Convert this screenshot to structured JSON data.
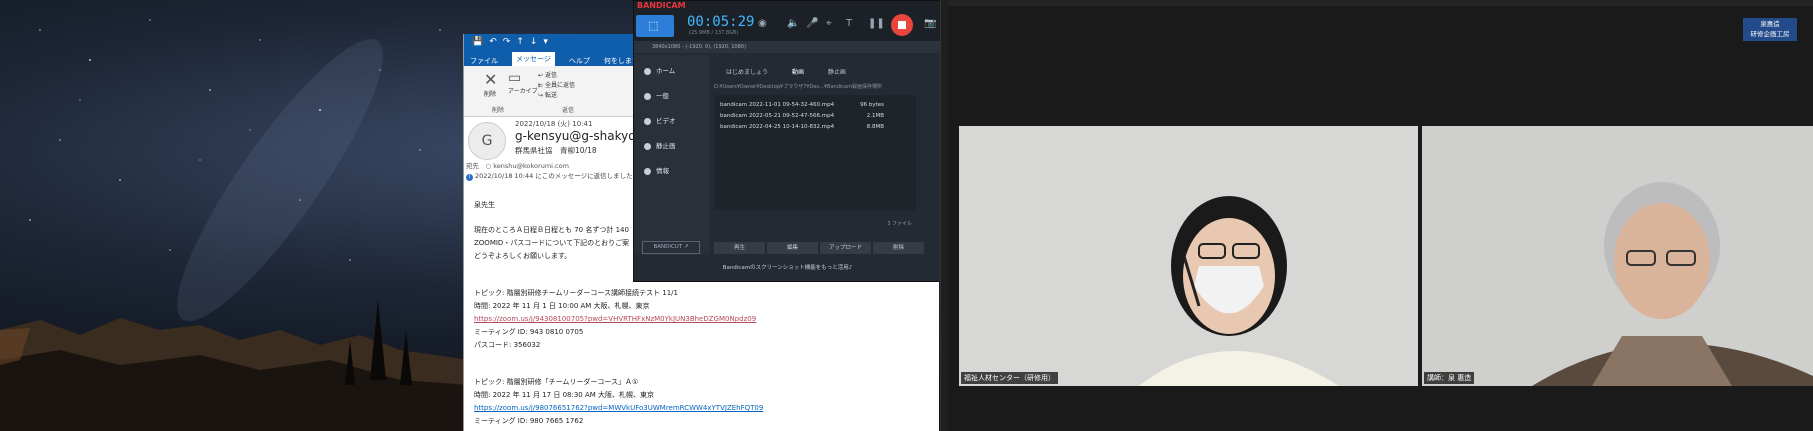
{
  "outlook": {
    "tabs": [
      "ファイル",
      "メッセージ",
      "ヘルプ",
      "何をしますか"
    ],
    "active_tab": "メッセージ",
    "ribbon": {
      "delete_label": "削除",
      "archive_label": "アーカイブ",
      "delete_group": "削除",
      "reply_label": "返信",
      "reply_all_label": "全員に返信",
      "forward_label": "転送",
      "reply_group": "返信"
    },
    "message": {
      "date": "2022/10/18 (火) 10:41",
      "from": "g-kensyu@g-shakyo.or",
      "org": "群馬県社協　青柳10/18",
      "to": "宛先　○ kenshu@kokorumi.com",
      "info": "2022/10/18 10:44 にこのメッセージに返信しました。",
      "avatar": "G"
    },
    "body": {
      "greeting": "泉先生",
      "p1": "現在のところＡ日程Ｂ日程とも 70 名ずつ計 140",
      "p2": "ZOOMID・パスコードについて下記のとおりご案",
      "p3": "どうぞよろしくお願いします。",
      "t1_topic": "トピック: 階層別研修チームリーダーコース講師接続テスト 11/1",
      "t1_time": "時間: 2022 年 11 月 1 日 10:00 AM 大阪、札幌、東京",
      "t1_link": "https://zoom.us/j/94308100705?pwd=VHVRTHFxNzM0YkJUN3BheDZGM0Npdz09",
      "t1_id": "ミーティング ID: 943 0810 0705",
      "t1_pass": "パスコード: 356032",
      "t2_topic": "トピック: 階層別研修「チームリーダーコース」Ａ①",
      "t2_time": "時間: 2022 年 11 月 17 日 08:30 AM 大阪、札幌、東京",
      "t2_link": "https://zoom.us/j/98076651762?pwd=MWVkUFo3UWMremRCWW4xYTVJZEhFQT09",
      "t2_id": "ミーティング ID: 980 7665 1762"
    }
  },
  "bandicam": {
    "logo": "BANDICAM",
    "timer": "00:05:29",
    "size_info": "(25.9MB / 137.8GB)",
    "resolution": "3840x1080 - (-1920, 0), (1920, 1080)",
    "sidebar": [
      "ホーム",
      "一般",
      "ビデオ",
      "静止画",
      "情報"
    ],
    "bandicut": "BANDICUT ↗",
    "tabs": [
      "はじめましょう",
      "動画",
      "静止画"
    ],
    "path": "D:¥Users¥Owner¥Desktop¥ブラウザ7¥Des...¥Bandicam録画保存場所",
    "files": [
      {
        "name": "bandicam 2022-11-01 09-54-32-460.mp4",
        "size": "96 bytes"
      },
      {
        "name": "bandicam 2022-05-21 09-52-47-566.mp4",
        "size": "2.1MB"
      },
      {
        "name": "bandicam 2022-04-25 10-14-10-832.mp4",
        "size": "8.8MB"
      }
    ],
    "count": "3 ファイル",
    "buttons": [
      "再生",
      "編集",
      "アップロード",
      "削除"
    ],
    "footer": "Bandicamのスクリーンショット機能をもっと活用♪"
  },
  "zoom": {
    "badge_line1": "泉惠造",
    "badge_line2": "研修企画工房",
    "tile1_name": "福祉人材センター（研修用）",
    "tile2_name": "講師：泉 惠造"
  }
}
